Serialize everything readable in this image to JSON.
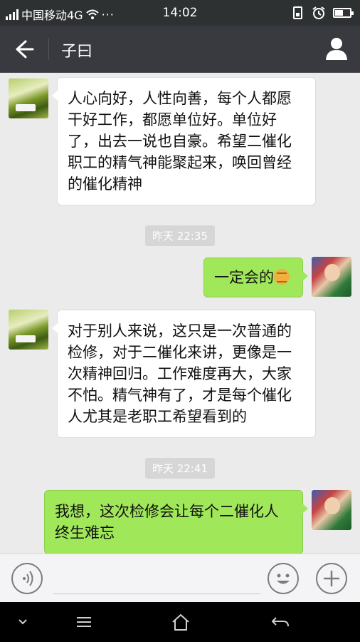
{
  "status_bar": {
    "carrier": "中国移动4G",
    "dots": "···",
    "time": "14:02"
  },
  "header": {
    "title": "子曰"
  },
  "messages": [
    {
      "side": "left",
      "text": "人心向好，人性向善，每个人都愿干好工作，都愿单位好。单位好了，出去一说也自豪。希望二催化职工的精气神能聚起来，唤回曾经的催化精神"
    },
    {
      "timestamp": "昨天 22:35"
    },
    {
      "side": "right",
      "text": "一定会的",
      "emoji": "fist-emoji"
    },
    {
      "side": "left",
      "text": "对于别人来说，这只是一次普通的检修，对于二催化来讲，更像是一次精神回归。工作难度再大，大家不怕。精气神有了，才是每个催化人尤其是老职工希望看到的"
    },
    {
      "timestamp": "昨天 22:41"
    },
    {
      "side": "right",
      "text": "我想，这次检修会让每个二催化人终生难忘"
    }
  ],
  "input": {
    "placeholder": ""
  },
  "colors": {
    "status_bar": "#2e3132",
    "nav_bar": "#393a3f",
    "chat_bg": "#ebebeb",
    "bubble_sent": "#a0e75a",
    "bubble_received": "#ffffff"
  },
  "icons": {
    "back": "arrow-left-icon",
    "profile": "person-icon",
    "voice": "voice-icon",
    "emoji": "smiley-icon",
    "more": "plus-icon",
    "sys_menu": "chevron-down-icon",
    "sys_recents": "hamburger-icon",
    "sys_home": "home-icon",
    "sys_back": "back-arrow-icon"
  }
}
